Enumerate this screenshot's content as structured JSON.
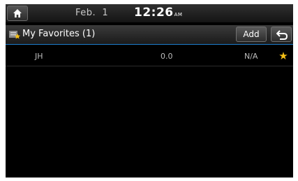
{
  "status": {
    "date": "Feb.  1",
    "time": "12:26",
    "ampm": "AM"
  },
  "header": {
    "title": "My Favorites (1)",
    "add_label": "Add"
  },
  "favorites": [
    {
      "name": "JH",
      "frequency": "0.0",
      "status": "N/A",
      "favorite_icon": "star-icon"
    }
  ],
  "colors": {
    "accent_line": "#1e7fd0",
    "star": "#f5c016"
  },
  "icons": {
    "home": "home-icon",
    "title": "favorites-list-icon",
    "back": "back-arrow-icon"
  }
}
